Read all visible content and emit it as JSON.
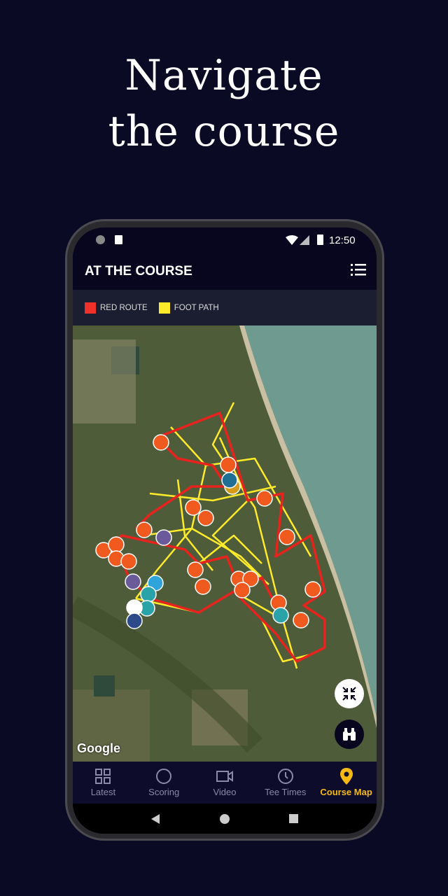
{
  "headline": {
    "line1": "Navigate",
    "line2": "the course"
  },
  "status_bar": {
    "time": "12:50"
  },
  "app_bar": {
    "title": "AT THE COURSE",
    "menu_icon": "list-icon"
  },
  "legend": [
    {
      "label": "RED ROUTE",
      "color": "#f0302a"
    },
    {
      "label": "FOOT PATH",
      "color": "#ffeb2a"
    }
  ],
  "map": {
    "attribution": "Google",
    "buttons": [
      "collapse-icon",
      "binoculars-icon"
    ]
  },
  "bottom_nav": [
    {
      "label": "Latest",
      "icon": "grid-icon",
      "active": false
    },
    {
      "label": "Scoring",
      "icon": "golf-ball-icon",
      "active": false
    },
    {
      "label": "Video",
      "icon": "video-icon",
      "active": false
    },
    {
      "label": "Tee Times",
      "icon": "clock-icon",
      "active": false
    },
    {
      "label": "Course Map",
      "icon": "location-pin-icon",
      "active": true
    }
  ],
  "colors": {
    "accent": "#f5b914",
    "background": "#0b0a24",
    "marker_orange": "#f05a1e"
  }
}
